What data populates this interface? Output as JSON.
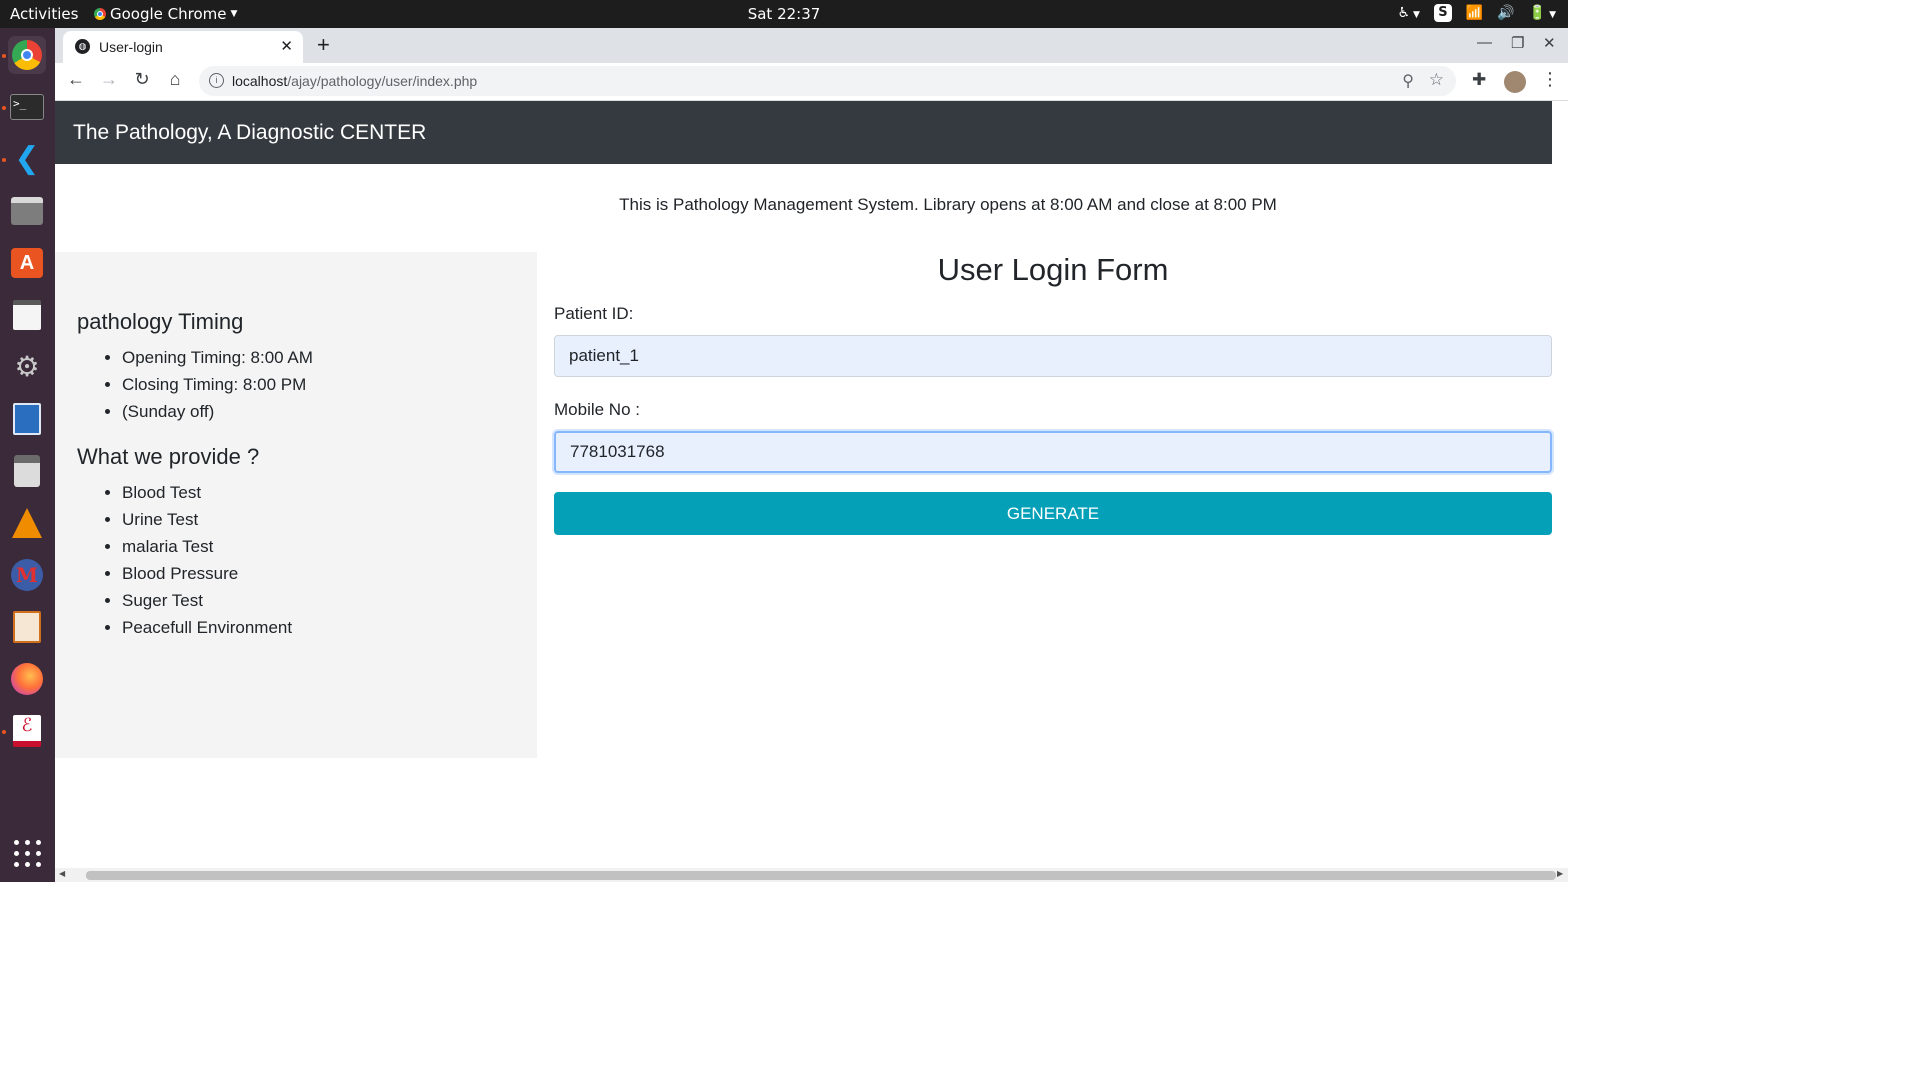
{
  "topbar": {
    "activities": "Activities",
    "app_name": "Google Chrome",
    "clock": "Sat 22:37"
  },
  "browser": {
    "tab_title": "User-login",
    "url_host": "localhost",
    "url_path": "/ajay/pathology/user/index.php"
  },
  "page": {
    "brand": "The Pathology, A Diagnostic CENTER",
    "notice": "This is Pathology Management System. Library opens at 8:00 AM and close at 8:00 PM",
    "sidebar": {
      "timing_heading": "pathology Timing",
      "timing_items": [
        "Opening Timing: 8:00 AM",
        "Closing Timing: 8:00 PM",
        "(Sunday off)"
      ],
      "provide_heading": "What we provide ?",
      "provide_items": [
        "Blood Test",
        "Urine Test",
        "malaria Test",
        "Blood Pressure",
        "Suger Test",
        "Peacefull Environment"
      ]
    },
    "form": {
      "title": "User Login Form",
      "patient_label": "Patient ID:",
      "patient_value": "patient_1",
      "mobile_label": "Mobile No :",
      "mobile_value": "7781031768",
      "button": "GENERATE"
    }
  },
  "colors": {
    "navbar": "#343a40",
    "button": "#03a0b8",
    "input_bg": "#e8f0fe",
    "sidebar_bg": "#f4f4f4",
    "dock": "#3b2a3a"
  }
}
